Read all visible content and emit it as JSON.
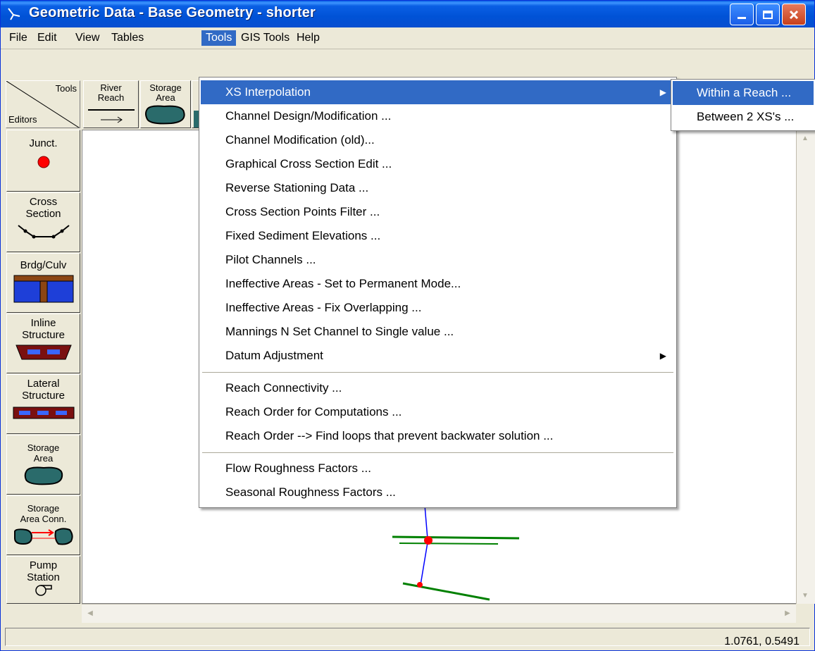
{
  "window": {
    "title": "Geometric Data - Base Geometry - shorter",
    "title_buttons": {
      "minimize": "_",
      "maximize": "□",
      "close": "✕"
    }
  },
  "menubar": {
    "items": [
      "File",
      "Edit",
      "View",
      "Tables",
      "Tools",
      "GIS Tools",
      "Help"
    ],
    "active": "Tools"
  },
  "toolbar": {
    "tools_label": "Tools",
    "editors_label": "Editors",
    "river_reach_label_1": "River",
    "river_reach_label_2": "Reach",
    "storage_area_label_1": "Storage",
    "storage_area_label_2": "Area"
  },
  "palette": {
    "junct": "Junct.",
    "cross_section_1": "Cross",
    "cross_section_2": "Section",
    "brdg_culv": "Brdg/Culv",
    "inline_1": "Inline",
    "inline_2": "Structure",
    "lateral_1": "Lateral",
    "lateral_2": "Structure",
    "storage_1": "Storage",
    "storage_2": "Area",
    "storage_conn_1": "Storage",
    "storage_conn_2": "Area Conn.",
    "pump_1": "Pump",
    "pump_2": "Station"
  },
  "tools_menu": {
    "items": [
      "XS Interpolation",
      "Channel Design/Modification ...",
      "Channel Modification (old)...",
      "Graphical Cross Section Edit ...",
      "Reverse Stationing Data ...",
      "Cross Section Points Filter ...",
      "Fixed Sediment Elevations ...",
      "Pilot Channels ...",
      "Ineffective Areas - Set to Permanent Mode...",
      "Ineffective Areas - Fix Overlapping  ...",
      "Mannings N Set Channel to Single value ...",
      "Datum Adjustment",
      "Reach Connectivity ...",
      "Reach Order for Computations ...",
      "Reach Order --> Find loops that prevent backwater solution ...",
      "Flow Roughness Factors ...",
      "Seasonal Roughness Factors ..."
    ],
    "highlighted": "XS Interpolation"
  },
  "xs_submenu": {
    "items": [
      "Within a Reach ...",
      "Between 2 XS's ..."
    ],
    "highlighted": "Within a Reach ..."
  },
  "statusbar": {
    "coordinates": "1.0761, 0.5491"
  },
  "colors": {
    "highlight": "#316ac5",
    "junction": "#ff0000",
    "river_line": "#0000ff",
    "cross_section": "#008000"
  }
}
